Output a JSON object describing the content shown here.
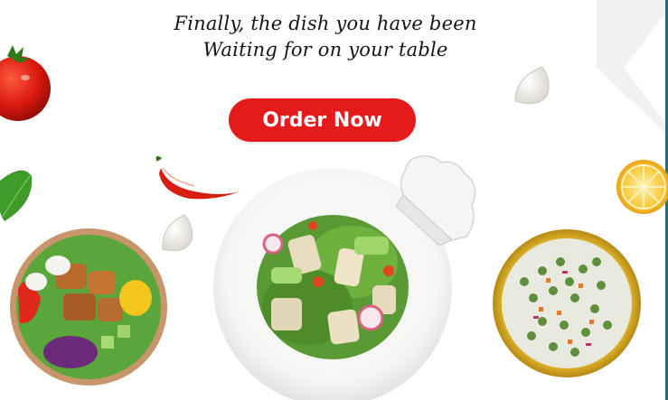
{
  "hero": {
    "headline_line1": "Finally, the dish you have been",
    "headline_line2": "Waiting for on your table",
    "order_button_label": "Order Now"
  },
  "colors": {
    "button": "#e51b1b",
    "accent_edge": "#2c6b73"
  },
  "icons": [
    "tomato",
    "basil-leaf",
    "chili-pepper",
    "garlic-clove",
    "chef-hat",
    "lemon-slice",
    "salmon-salad-bowl",
    "chicken-salad-plate",
    "pea-salad-bowl"
  ]
}
